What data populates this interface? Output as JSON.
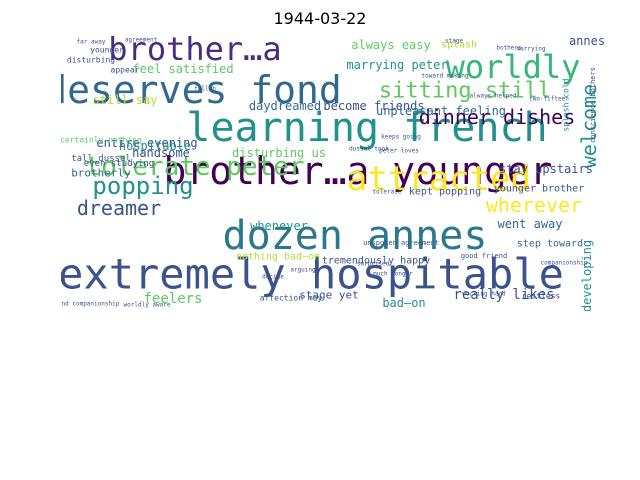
{
  "title": "1944-03-22",
  "chart_data": {
    "type": "wordcloud",
    "title": "1944-03-22",
    "colormap": "viridis",
    "background": "#ffffff",
    "words": [
      {
        "text": "extremely hospitable",
        "weight": 1.0,
        "color": "#3b528b"
      },
      {
        "text": "dozen annes",
        "weight": 0.92,
        "color": "#2a788e"
      },
      {
        "text": "learning french",
        "weight": 0.9,
        "color": "#21918c"
      },
      {
        "text": "brother…a younger",
        "weight": 0.85,
        "color": "#440154"
      },
      {
        "text": "deserves fond",
        "weight": 0.8,
        "color": "#31688e"
      },
      {
        "text": "worldly",
        "weight": 0.8,
        "color": "#35b779"
      },
      {
        "text": "brother…a",
        "weight": 0.78,
        "color": "#472d7b"
      },
      {
        "text": "attracted",
        "weight": 0.72,
        "color": "#fde725"
      },
      {
        "text": "tolerate peter",
        "weight": 0.6,
        "color": "#5ec962"
      },
      {
        "text": "sitting still",
        "weight": 0.58,
        "color": "#5ec962"
      },
      {
        "text": "popping",
        "weight": 0.55,
        "color": "#21918c"
      },
      {
        "text": "wherever",
        "weight": 0.5,
        "color": "#fde725"
      },
      {
        "text": "dinner dishes",
        "weight": 0.45,
        "color": "#440154"
      },
      {
        "text": "dreamer",
        "weight": 0.45,
        "color": "#3b528b"
      },
      {
        "text": "welcome",
        "weight": 0.45,
        "color": "#21918c"
      },
      {
        "text": "always easy",
        "weight": 0.25,
        "color": "#5ec962"
      },
      {
        "text": "feel satisfied",
        "weight": 0.25,
        "color": "#5ec962"
      },
      {
        "text": "marrying peter",
        "weight": 0.25,
        "color": "#21918c"
      },
      {
        "text": "entire evening",
        "weight": 0.25,
        "color": "#3b528b"
      },
      {
        "text": "still say",
        "weight": 0.25,
        "color": "#b5de2b"
      },
      {
        "text": "hospitable",
        "weight": 0.25,
        "color": "#21918c"
      },
      {
        "text": "daydreamed",
        "weight": 0.25,
        "color": "#31688e"
      },
      {
        "text": "become friends",
        "weight": 0.22,
        "color": "#3b528b"
      },
      {
        "text": "unpleasant feeling",
        "weight": 0.2,
        "color": "#31688e"
      },
      {
        "text": "handsome",
        "weight": 0.25,
        "color": "#3b528b"
      },
      {
        "text": "disturbing us",
        "weight": 0.25,
        "color": "#5ec962"
      },
      {
        "text": "went away",
        "weight": 0.25,
        "color": "#31688e"
      },
      {
        "text": "stay upstairs",
        "weight": 0.22,
        "color": "#3b528b"
      },
      {
        "text": "kept popping",
        "weight": 0.2,
        "color": "#3b528b"
      },
      {
        "text": "younger brother",
        "weight": 0.2,
        "color": "#3b528b"
      },
      {
        "text": "step toward",
        "weight": 0.2,
        "color": "#31688e"
      },
      {
        "text": "feelers",
        "weight": 0.25,
        "color": "#5ec962"
      },
      {
        "text": "really likes",
        "weight": 0.25,
        "color": "#3b528b"
      },
      {
        "text": "bad—on",
        "weight": 0.22,
        "color": "#21918c"
      },
      {
        "text": "whenever",
        "weight": 0.22,
        "color": "#21918c"
      },
      {
        "text": "developing",
        "weight": 0.2,
        "color": "#21918c"
      },
      {
        "text": "stage yet",
        "weight": 0.2,
        "color": "#3b528b"
      },
      {
        "text": "tremendously happy",
        "weight": 0.18,
        "color": "#3b528b"
      },
      {
        "text": "nothing bad—on",
        "weight": 0.18,
        "color": "#b5de2b"
      },
      {
        "text": "brotherly",
        "weight": 0.18,
        "color": "#31688e"
      },
      {
        "text": "tall dussel",
        "weight": 0.15,
        "color": "#3b528b"
      },
      {
        "text": "even studying",
        "weight": 0.15,
        "color": "#3b528b"
      },
      {
        "text": "certainly nothing",
        "weight": 0.12,
        "color": "#5ec962"
      },
      {
        "text": "affection may",
        "weight": 0.12,
        "color": "#3b528b"
      },
      {
        "text": "annes",
        "weight": 0.15,
        "color": "#3b528b"
      },
      {
        "text": "younger",
        "weight": 0.12,
        "color": "#3b528b"
      },
      {
        "text": "splash",
        "weight": 0.12,
        "color": "#b5de2b"
      },
      {
        "text": "appear",
        "weight": 0.12,
        "color": "#3b528b"
      },
      {
        "text": "disturbing",
        "weight": 0.1,
        "color": "#3b528b"
      },
      {
        "text": "splash cold",
        "weight": 0.1,
        "color": "#21918c"
      },
      {
        "text": "conscience bothers",
        "weight": 0.08,
        "color": "#3b528b"
      },
      {
        "text": "agreement",
        "weight": 0.08,
        "color": "#3b528b"
      },
      {
        "text": "far away",
        "weight": 0.08,
        "color": "#3b528b"
      },
      {
        "text": "stage",
        "weight": 0.08,
        "color": "#3b528b"
      },
      {
        "text": "bothers",
        "weight": 0.08,
        "color": "#3b528b"
      },
      {
        "text": "marrying",
        "weight": 0.08,
        "color": "#3b528b"
      },
      {
        "text": "toward making",
        "weight": 0.08,
        "color": "#3b528b"
      },
      {
        "text": "good friend",
        "weight": 0.08,
        "color": "#3b528b"
      },
      {
        "text": "working hard",
        "weight": 0.08,
        "color": "#3b528b"
      },
      {
        "text": "restless",
        "weight": 0.08,
        "color": "#3b528b"
      },
      {
        "text": "companionship",
        "weight": 0.08,
        "color": "#3b528b"
      },
      {
        "text": "found companionship",
        "weight": 0.08,
        "color": "#3b528b"
      },
      {
        "text": "worldly aware",
        "weight": 0.08,
        "color": "#3b528b"
      },
      {
        "text": "unspoken agreement",
        "weight": 0.08,
        "color": "#3b528b"
      },
      {
        "text": "surprised",
        "weight": 0.08,
        "color": "#3b528b"
      },
      {
        "text": "tolerate",
        "weight": 0.08,
        "color": "#3b528b"
      },
      {
        "text": "arguing",
        "weight": 0.08,
        "color": "#3b528b"
      },
      {
        "text": "decide",
        "weight": 0.08,
        "color": "#3b528b"
      },
      {
        "text": "keeps going",
        "weight": 0.08,
        "color": "#3b528b"
      },
      {
        "text": "much longer",
        "weight": 0.08,
        "color": "#3b528b"
      },
      {
        "text": "peter loves",
        "weight": 0.08,
        "color": "#3b528b"
      },
      {
        "text": "dussel took",
        "weight": 0.08,
        "color": "#3b528b"
      },
      {
        "text": "always helped",
        "weight": 0.08,
        "color": "#3b528b"
      },
      {
        "text": "two-fifteen",
        "weight": 0.08,
        "color": "#3b528b"
      },
      {
        "text": "fallen",
        "weight": 0.08,
        "color": "#3b528b"
      }
    ]
  }
}
